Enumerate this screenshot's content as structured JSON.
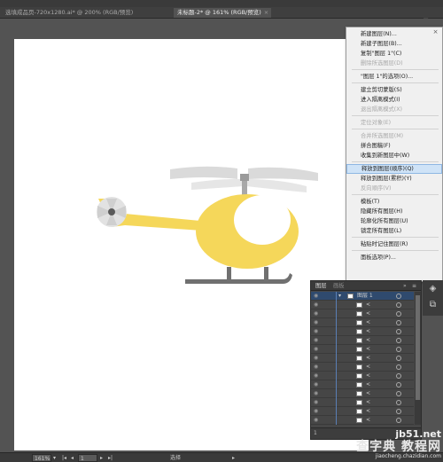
{
  "tabs": [
    {
      "label": "选填成品页-720x1280.ai* @ 200% (RGB/预览)",
      "active": false
    },
    {
      "label": "未标题-2* @ 161% (RGB/预览)",
      "active": true
    }
  ],
  "context_menu": {
    "items": [
      {
        "label": "新建图层(N)...",
        "disabled": false
      },
      {
        "label": "新建子图层(B)...",
        "disabled": false
      },
      {
        "label": "复制\"图层 1\"(C)",
        "disabled": false
      },
      {
        "label": "删除所选图层(D)",
        "disabled": true
      },
      {
        "sep": true
      },
      {
        "label": "\"图层 1\"的选项(O)...",
        "disabled": false
      },
      {
        "sep": true
      },
      {
        "label": "建立剪切蒙版(S)",
        "disabled": false
      },
      {
        "label": "进入隔离模式(I)",
        "disabled": false
      },
      {
        "label": "退出隔离模式(X)",
        "disabled": true
      },
      {
        "sep": true
      },
      {
        "label": "定位对象(E)",
        "disabled": true
      },
      {
        "sep": true
      },
      {
        "label": "合并所选图层(M)",
        "disabled": true
      },
      {
        "label": "拼合图稿(F)",
        "disabled": false
      },
      {
        "label": "收集到新图层中(W)",
        "disabled": false
      },
      {
        "sep": true
      },
      {
        "label": "释放到图层(顺序)(Q)",
        "disabled": false,
        "highlighted": true
      },
      {
        "label": "释放到图层(累积)(Y)",
        "disabled": false
      },
      {
        "label": "反向顺序(V)",
        "disabled": true
      },
      {
        "sep": true
      },
      {
        "label": "模板(T)",
        "disabled": false
      },
      {
        "label": "隐藏所有图层(H)",
        "disabled": false
      },
      {
        "label": "轮廓化所有图层(U)",
        "disabled": false
      },
      {
        "label": "锁定所有图层(L)",
        "disabled": false
      },
      {
        "sep": true
      },
      {
        "label": "粘贴时记住图层(R)",
        "disabled": false
      },
      {
        "sep": true
      },
      {
        "label": "面板选项(P)...",
        "disabled": false
      }
    ]
  },
  "layers_panel": {
    "tabs": [
      "图层",
      "画板"
    ],
    "layer_name": "图层 1",
    "sublayer_label": "<",
    "sublayer_count": 15
  },
  "status": {
    "zoom": "161%",
    "page": "1",
    "tool": "选择"
  },
  "watermark": {
    "url": "jb51.net",
    "cn": "查字典 教程网",
    "sub": "jiaocheng.chazidian.com"
  },
  "colors": {
    "heli_body": "#f5d75a",
    "heli_grey": "#d8d8d8",
    "heli_dark": "#5a5a5a",
    "menu_highlight": "#cfe3f7"
  }
}
